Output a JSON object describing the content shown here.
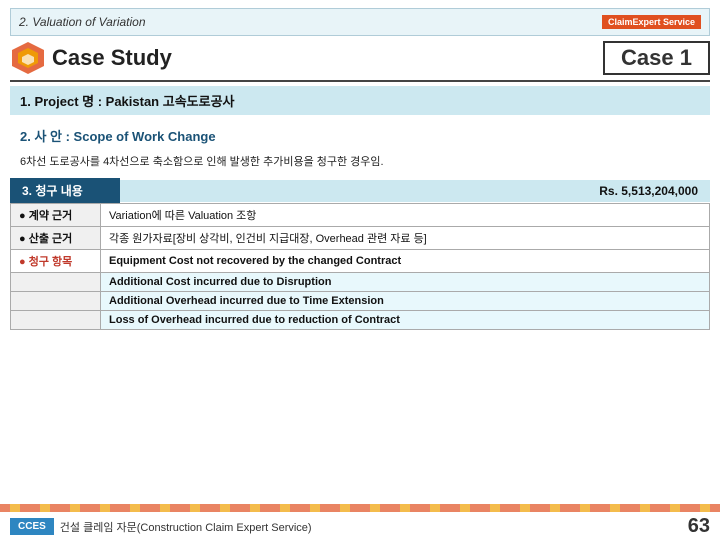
{
  "header": {
    "title": "2.  Valuation of Variation",
    "badge": "ClaimExpert Service"
  },
  "title_row": {
    "case_study": "Case Study",
    "case_number": "Case  1"
  },
  "section1": {
    "label": "1. Project 명 : Pakistan 고속도로공사"
  },
  "section2": {
    "label": "2. 사 안 : Scope of Work Change",
    "description": "6차선 도로공사를 4차선으로 축소함으로 인해 발생한 추가비용을 청구한 경우임."
  },
  "section3": {
    "label": "3. 청구 내용",
    "amount": "Rs. 5,513,204,000",
    "rows": [
      {
        "label": "● 계약 근거",
        "label_class": "normal",
        "value": "Variation에 따른 Valuation 조항"
      },
      {
        "label": "● 산출 근거",
        "label_class": "normal",
        "value": "각종 원가자료[장비 상각비, 인건비 지급대장, Overhead 관련 자료 등]"
      },
      {
        "label": "● 청구 항목",
        "label_class": "highlight",
        "value": "Equipment Cost not recovered by the changed Contract",
        "value_class": "bold-item"
      },
      {
        "label": "",
        "label_class": "normal",
        "value": "Additional Cost incurred due to Disruption",
        "value_class": "cyan-bg"
      },
      {
        "label": "",
        "label_class": "normal",
        "value": "Additional Overhead incurred due to Time Extension",
        "value_class": "cyan-bg"
      },
      {
        "label": "",
        "label_class": "normal",
        "value": "Loss of Overhead incurred due to reduction of Contract",
        "value_class": "cyan-bg"
      }
    ]
  },
  "bottom": {
    "cces": "CCES",
    "label": "건설 클레임 자문(Construction Claim Expert Service)",
    "page": "63"
  }
}
